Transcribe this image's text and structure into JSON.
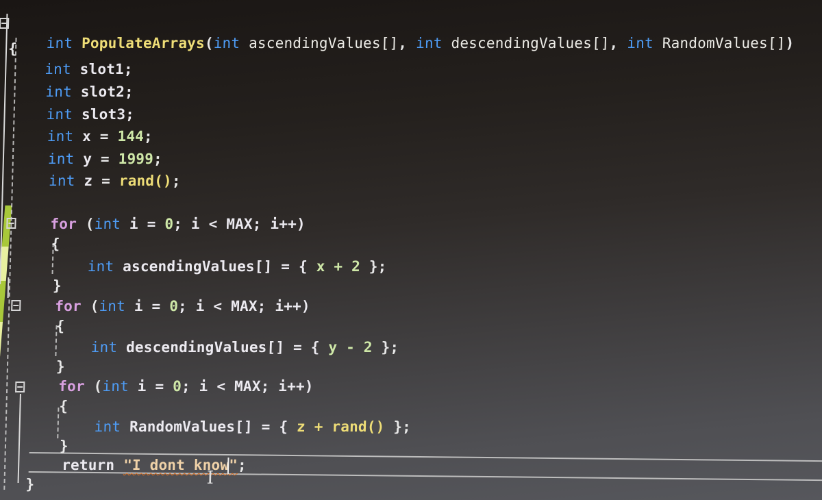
{
  "editor": {
    "theme": "dark",
    "signature": {
      "return_type": "int",
      "name": "PopulateArrays",
      "open": "(",
      "params": [
        {
          "type": "int",
          "name": "ascendingValues[]",
          "sep": ", "
        },
        {
          "type": "int",
          "name": "descendingValues[]",
          "sep": ", "
        },
        {
          "type": "int",
          "name": "RandomValues[]",
          "sep": ")"
        }
      ]
    },
    "open_brace": "{",
    "close_brace": "}",
    "declarations": [
      {
        "type": "int",
        "rest": "slot1;"
      },
      {
        "type": "int",
        "rest": "slot2;"
      },
      {
        "type": "int",
        "rest": "slot3;"
      },
      {
        "type": "int",
        "name": "x",
        "op": " = ",
        "value": "144",
        "end": ";"
      },
      {
        "type": "int",
        "name": "y",
        "op": " = ",
        "value": "1999",
        "end": ";"
      },
      {
        "type": "int",
        "name": "z",
        "op": " = ",
        "value": "rand()",
        "end": ";"
      }
    ],
    "loops": [
      {
        "for_kw": "for",
        "header_open": " (",
        "int_kw": "int",
        "header_rest": " i = ",
        "zero": "0",
        "header_tail": "; i < MAX; i++)",
        "open": "{",
        "body_type": "int",
        "body_name": "ascendingValues[] = { ",
        "body_expr": "x + 2",
        "body_end": " };",
        "close": "}"
      },
      {
        "for_kw": "for",
        "header_open": " (",
        "int_kw": "int",
        "header_rest": " i = ",
        "zero": "0",
        "header_tail": "; i < MAX; i++)",
        "open": "{",
        "body_type": "int",
        "body_name": "descendingValues[] = { ",
        "body_expr": "y - 2",
        "body_end": " };",
        "close": "}"
      },
      {
        "for_kw": "for",
        "header_open": " (",
        "int_kw": "int",
        "header_rest": " i = ",
        "zero": "0",
        "header_tail": "; i < MAX; i++)",
        "open": "{",
        "body_type": "int",
        "body_name": "RandomValues[] = { ",
        "body_expr": "z + rand()",
        "body_end": " };",
        "close": "}"
      }
    ],
    "return_stmt": {
      "keyword": "return",
      "string": "\"I dont know\"",
      "end": ";"
    },
    "fold_glyph": "minus",
    "colors": {
      "keyword": "#4e9cf5",
      "control": "#d8a0e0",
      "function": "#eedd77",
      "number": "#cfe8a8",
      "string": "#f0d2a8",
      "error_squiggle": "#e07020",
      "change_bar": "#a8c83a"
    }
  }
}
